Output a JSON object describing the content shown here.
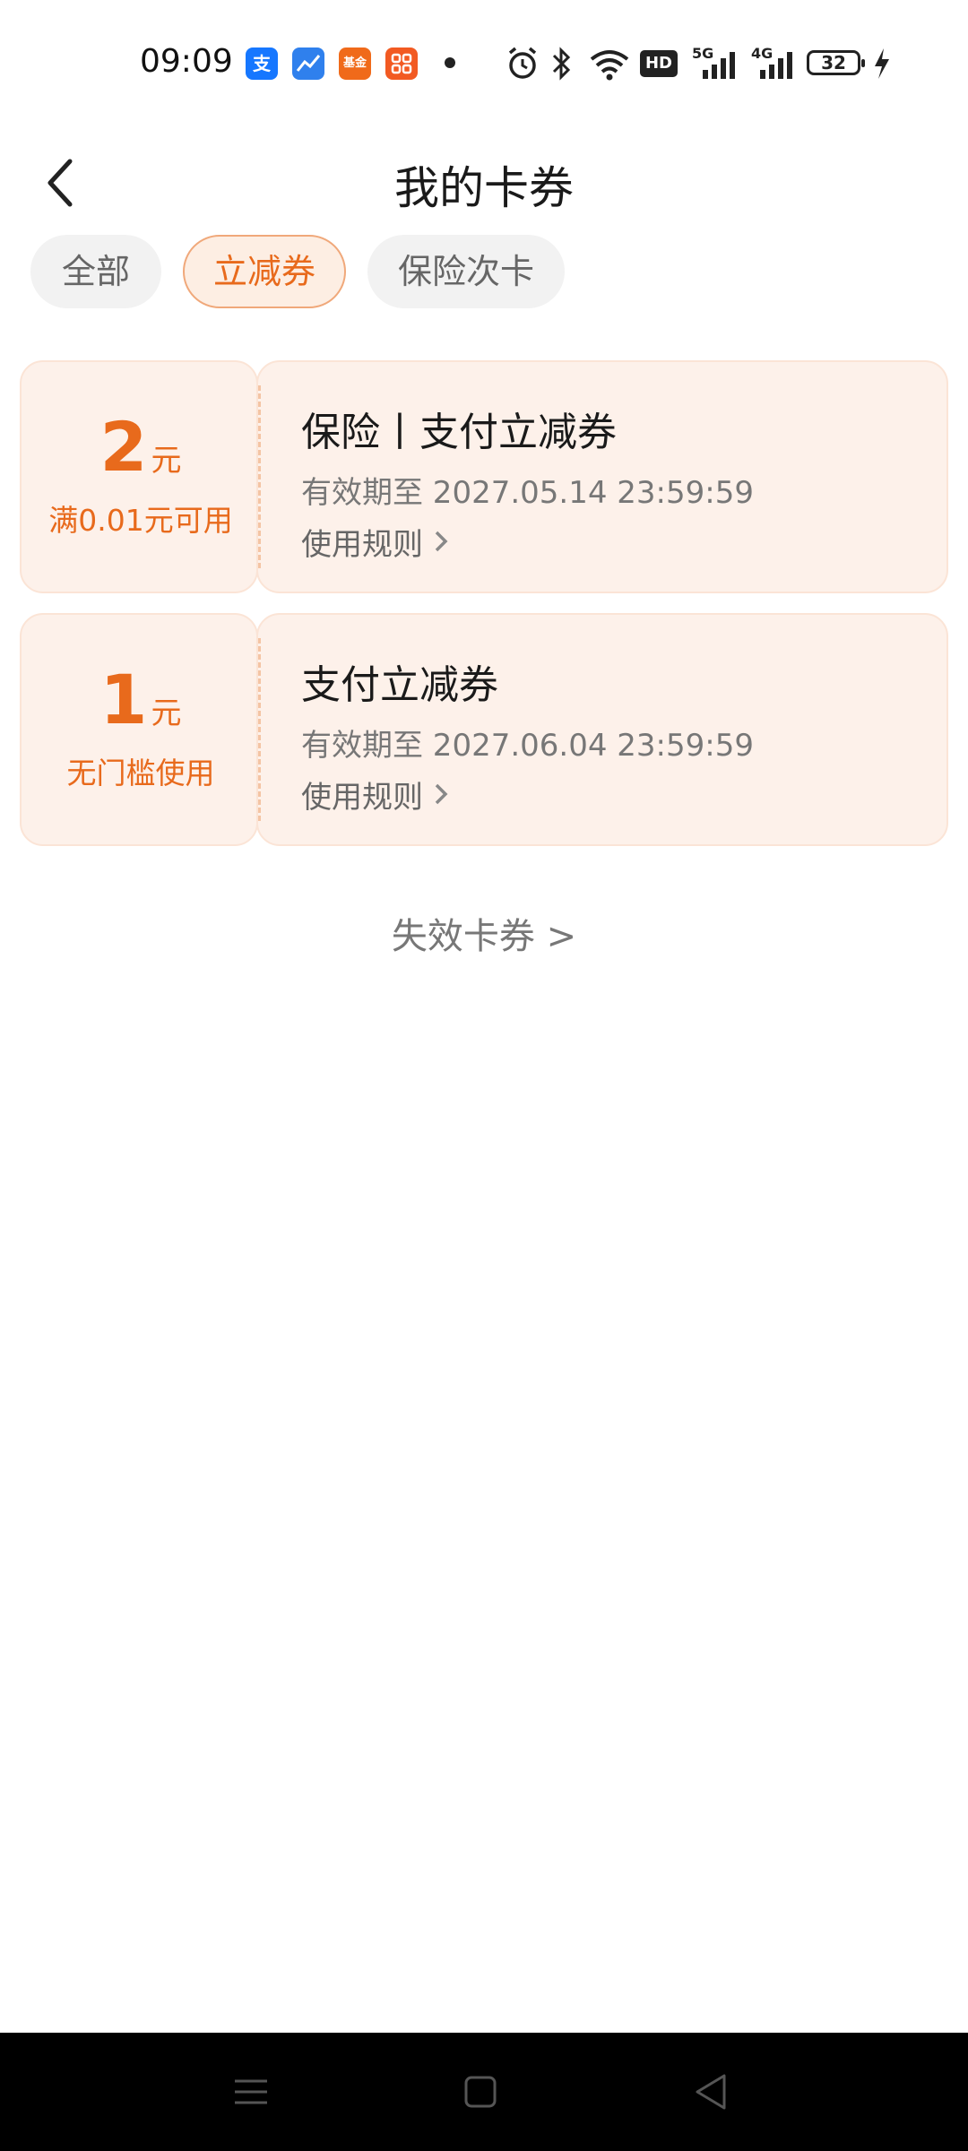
{
  "status_bar": {
    "time": "09:09",
    "app_icons": [
      {
        "name": "alipay-icon",
        "glyph": "支",
        "color": "#1677ff"
      },
      {
        "name": "stock-app-icon",
        "glyph": "",
        "color": "#2f80ed"
      },
      {
        "name": "fund-app-icon",
        "glyph": "基金",
        "color": "#f06a1a"
      },
      {
        "name": "grid-app-icon",
        "glyph": "",
        "color": "#f25a22"
      }
    ],
    "battery": "32",
    "network_5g": "5G",
    "network_4g": "4G",
    "hd_label": "HD"
  },
  "header": {
    "title": "我的卡券"
  },
  "tabs": [
    {
      "label": "全部",
      "active": false
    },
    {
      "label": "立减券",
      "active": true
    },
    {
      "label": "保险次卡",
      "active": false
    }
  ],
  "coupons": [
    {
      "amount": "2",
      "unit": "元",
      "condition": "满0.01元可用",
      "title": "保险丨支付立减券",
      "expiry": "有效期至 2027.05.14 23:59:59",
      "rules_label": "使用规则"
    },
    {
      "amount": "1",
      "unit": "元",
      "condition": "无门槛使用",
      "title": "支付立减券",
      "expiry": "有效期至 2027.06.04 23:59:59",
      "rules_label": "使用规则"
    }
  ],
  "expired_link": "失效卡券 >",
  "colors": {
    "accent": "#e86a1c",
    "coupon_bg": "#fdf1ea",
    "tab_active_border": "#f0a87a"
  }
}
